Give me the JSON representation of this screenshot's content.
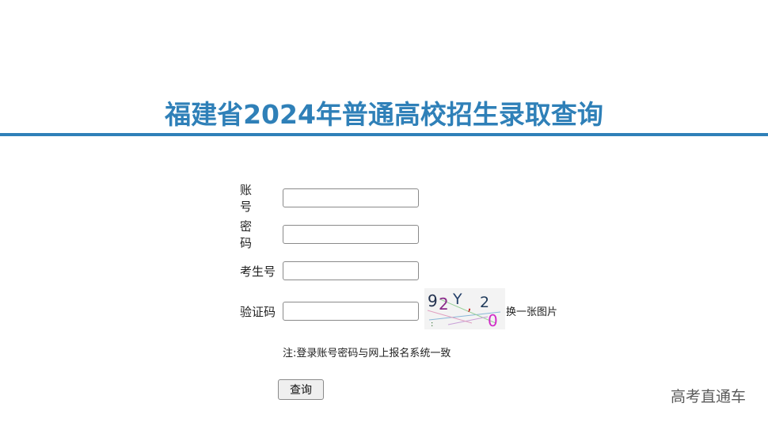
{
  "page": {
    "title": "福建省2024年普通高校招生录取查询",
    "accent_color": "#2f80b8"
  },
  "form": {
    "account_label": "账 号",
    "password_label": "密 码",
    "exam_number_label": "考生号",
    "captcha_label": "验证码",
    "change_image_text": "换一张图片",
    "note_text": "注:登录账号密码与网上报名系统一致",
    "submit_label": "查询",
    "captcha_text": "92Y,20"
  },
  "watermark": {
    "text": "高考直通车"
  }
}
